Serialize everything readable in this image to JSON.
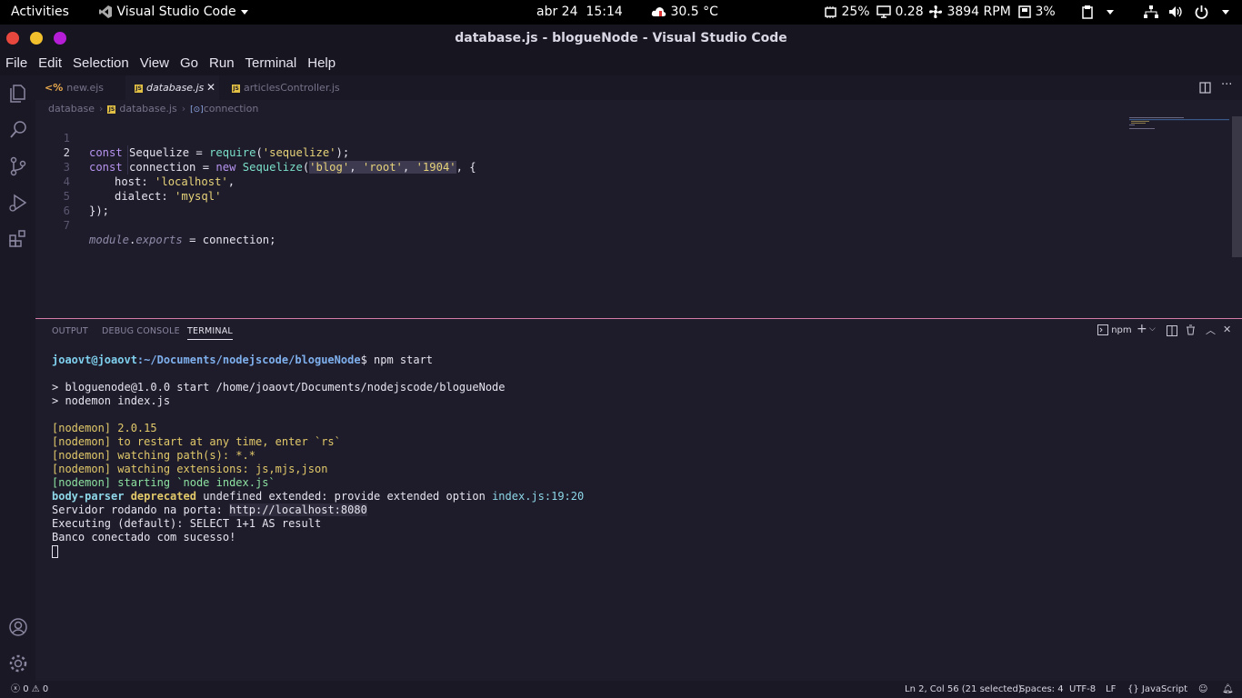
{
  "system_bar": {
    "activities": "Activities",
    "app_name": "Visual Studio Code",
    "date": "abr 24",
    "time": "15:14",
    "temperature": "30.5 °C",
    "cpu": "25%",
    "load": "0.28",
    "fan": "3894 RPM",
    "disk": "3%"
  },
  "window": {
    "title": "database.js - blogueNode - Visual Studio Code"
  },
  "menu": [
    "File",
    "Edit",
    "Selection",
    "View",
    "Go",
    "Run",
    "Terminal",
    "Help"
  ],
  "tabs": [
    {
      "label": "new.ejs",
      "kind": "ejs"
    },
    {
      "label": "database.js",
      "kind": "js",
      "active": true
    },
    {
      "label": "articlesController.js",
      "kind": "js"
    }
  ],
  "breadcrumb": {
    "folder": "database",
    "file": "database.js",
    "symbol": "connection"
  },
  "editor": {
    "current_line": 2,
    "line_numbers": [
      "1",
      "2",
      "3",
      "4",
      "5",
      "6",
      "7"
    ],
    "l1": {
      "kw": "const",
      "name": " Sequelize = ",
      "fn": "require",
      "open": "(",
      "str": "'sequelize'",
      "close": ");"
    },
    "l2": {
      "kw": "const",
      "name": " connection = ",
      "new": "new",
      "cls": " Sequelize",
      "open": "(",
      "s1": "'blog'",
      "c1": ", ",
      "s2": "'root'",
      "c2": ", ",
      "s3": "'1904'",
      "close": ", {"
    },
    "l3": {
      "key": "host: ",
      "str": "'localhost'",
      "end": ","
    },
    "l4": {
      "key": "dialect: ",
      "str": "'mysql'"
    },
    "l5": {
      "text": "});"
    },
    "l7": {
      "mod": "module",
      "dot": ".",
      "exp": "exports",
      "rest": " = connection;"
    }
  },
  "panel": {
    "tabs": [
      "OUTPUT",
      "DEBUG CONSOLE",
      "TERMINAL"
    ],
    "terminal_label": "npm"
  },
  "terminal": {
    "prompt_user": "joaovt@joaovt",
    "prompt_path": ":~/Documents/nodejscode/blogueNode",
    "command": "$ npm start",
    "lines": [
      "> bloguenode@1.0.0 start /home/joaovt/Documents/nodejscode/blogueNode",
      "> nodemon index.js"
    ],
    "nodemon": [
      "[nodemon] 2.0.15",
      "[nodemon] to restart at any time, enter `rs`",
      "[nodemon] watching path(s): *.*",
      "[nodemon] watching extensions: js,mjs,json"
    ],
    "nodemon_start": "[nodemon] starting `node index.js`",
    "deprecation": {
      "pkg": "body-parser",
      "word": " deprecated",
      "msg": " undefined extended: provide extended option ",
      "loc": "index.js:19:20"
    },
    "server_prefix": "Servidor rodando na porta: ",
    "server_url": "http://localhost:8080",
    "executing": "Executing (default): SELECT 1+1 AS result",
    "connected": "Banco conectado com sucesso!"
  },
  "status_bar": {
    "errors": "0",
    "warnings": "0",
    "position": "Ln 2, Col 56 (21 selected)",
    "spaces": "Spaces: 4",
    "encoding": "UTF-8",
    "eol": "LF",
    "language": "JavaScript"
  }
}
